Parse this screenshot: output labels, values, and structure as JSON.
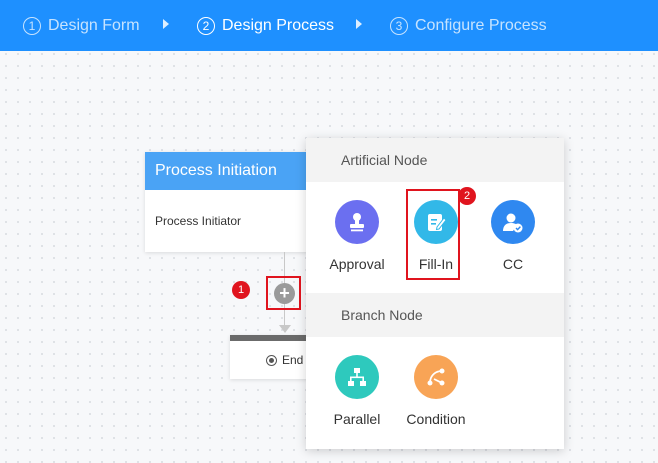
{
  "steps": [
    {
      "num": "1",
      "label": "Design Form",
      "state": "inactive"
    },
    {
      "num": "2",
      "label": "Design Process",
      "state": "active"
    },
    {
      "num": "3",
      "label": "Configure Process",
      "state": "inactive"
    }
  ],
  "canvas": {
    "initiation": {
      "title": "Process Initiation",
      "body": "Process Initiator"
    },
    "add_button": "+",
    "end_label": "End",
    "badge_add": "1"
  },
  "popup": {
    "artificial": {
      "title": "Artificial Node",
      "nodes": [
        {
          "label": "Approval",
          "icon": "stamp-icon",
          "color": "#6b6ff0"
        },
        {
          "label": "Fill-In",
          "icon": "edit-form-icon",
          "color": "#32b8e8"
        },
        {
          "label": "CC",
          "icon": "user-cc-icon",
          "color": "#2f88f0"
        }
      ]
    },
    "branch": {
      "title": "Branch Node",
      "nodes": [
        {
          "label": "Parallel",
          "icon": "parallel-icon",
          "color": "#2ec9bd"
        },
        {
          "label": "Condition",
          "icon": "condition-icon",
          "color": "#f8a456"
        }
      ]
    },
    "badge_fill": "2"
  },
  "colors": {
    "header": "#1e90ff",
    "card_head": "#4aa3f5",
    "highlight": "#e0141e"
  }
}
